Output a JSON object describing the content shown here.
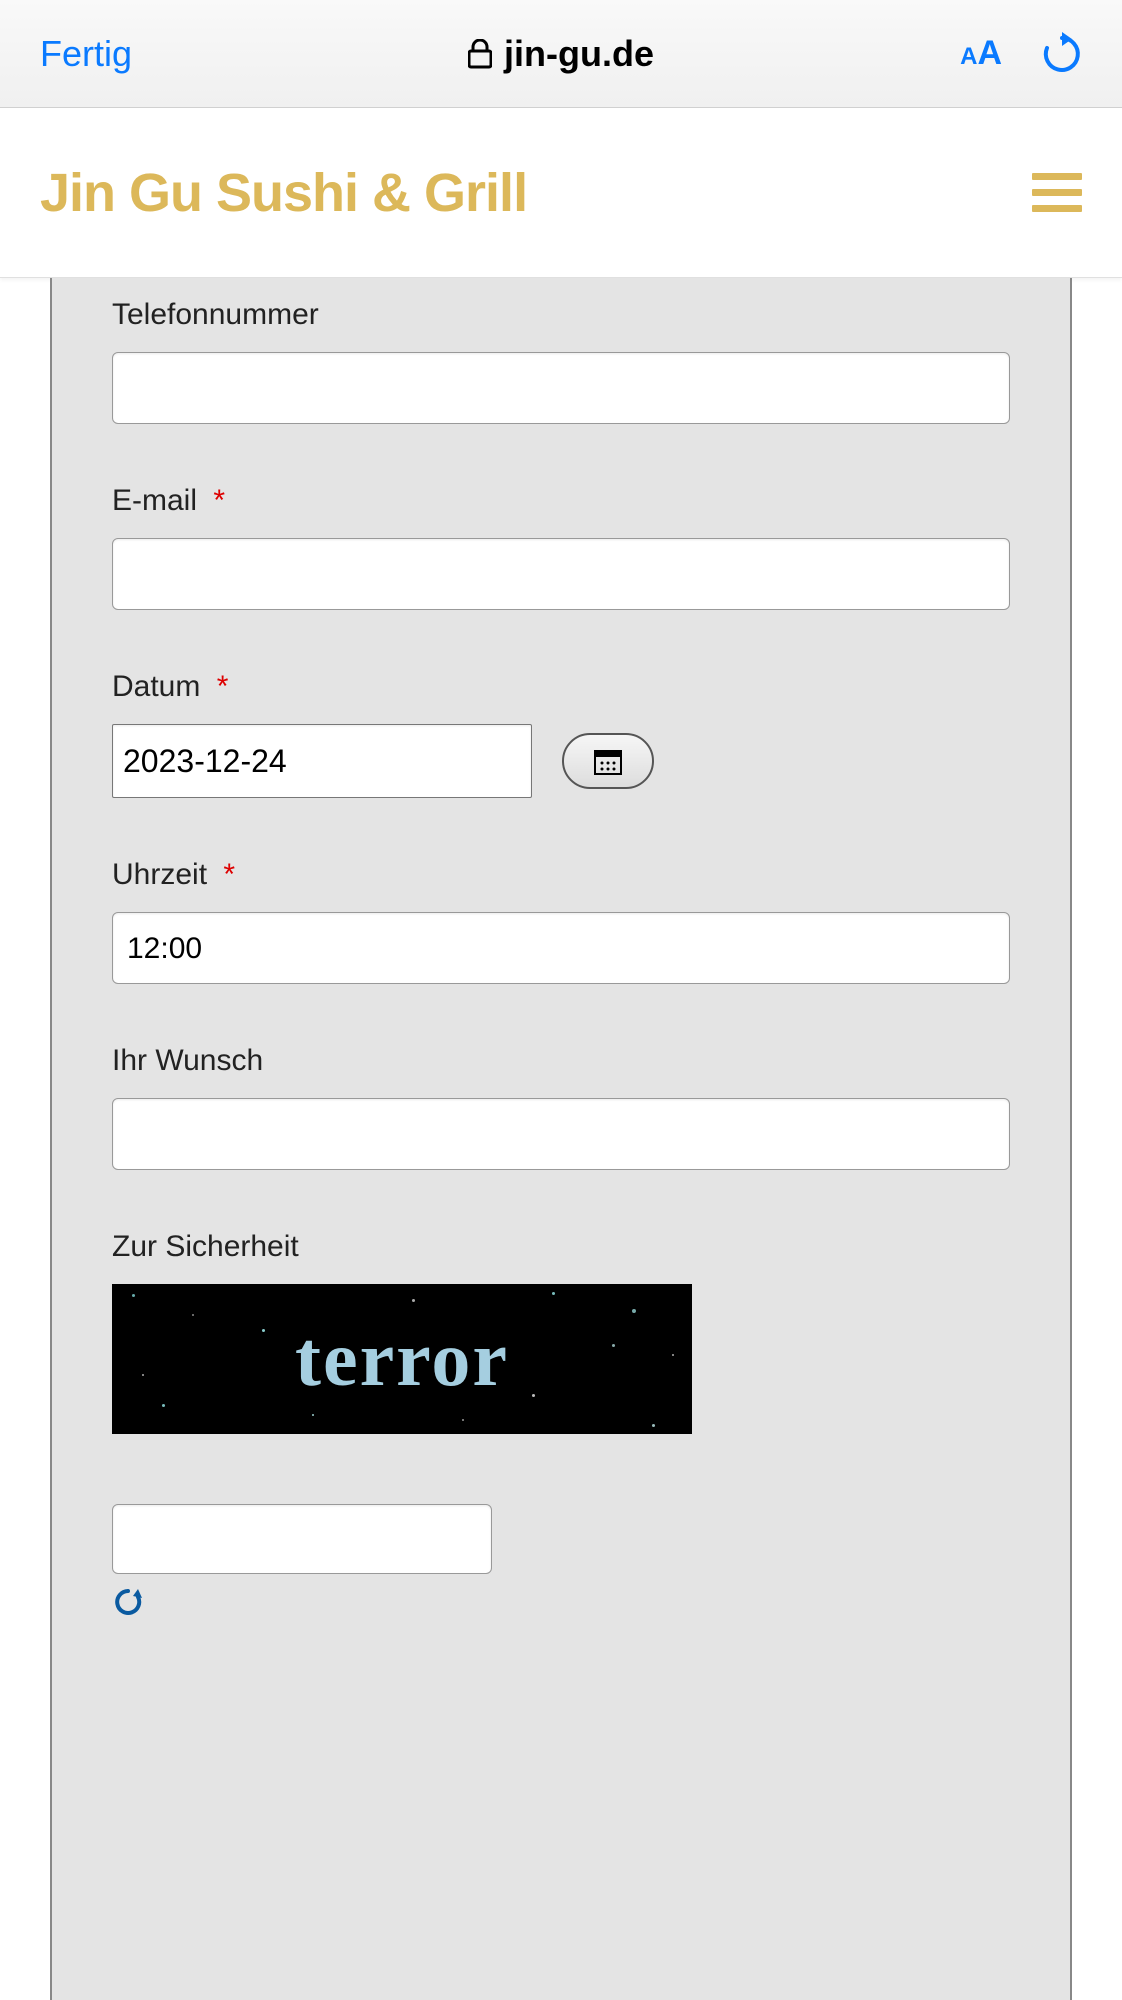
{
  "browser": {
    "done_label": "Fertig",
    "url_text": "jin-gu.de"
  },
  "header": {
    "site_title": "Jin Gu Sushi & Grill"
  },
  "form": {
    "telefon": {
      "label": "Telefonnummer",
      "value": ""
    },
    "email": {
      "label": "E-mail",
      "required": "*",
      "value": ""
    },
    "datum": {
      "label": "Datum",
      "required": "*",
      "value": "2023-12-24"
    },
    "uhrzeit": {
      "label": "Uhrzeit",
      "required": "*",
      "value": "12:00"
    },
    "wunsch": {
      "label": "Ihr Wunsch",
      "value": ""
    },
    "captcha": {
      "label": "Zur Sicherheit",
      "text": "terror",
      "input_value": ""
    }
  }
}
